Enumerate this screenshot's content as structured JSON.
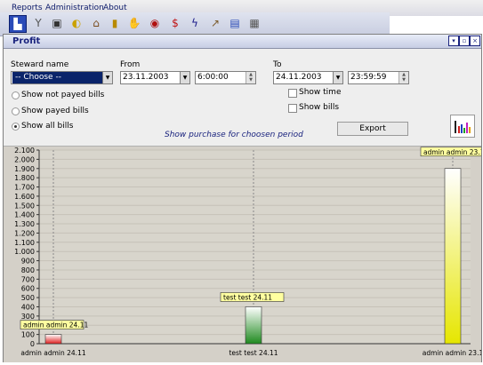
{
  "menu": [
    "Reports",
    "Administration",
    "About"
  ],
  "toolbar_icons": [
    "users-icon",
    "cocktail-icon",
    "monitor-icon",
    "drink-icon",
    "shop-icon",
    "bottle-icon",
    "scroll-icon",
    "money-icon",
    "cash-icon",
    "lightning-icon",
    "chart-icon",
    "card-icon",
    "document-icon"
  ],
  "window": {
    "title": "Profit"
  },
  "form": {
    "steward_label": "Steward name",
    "steward_value": "-- Choose --",
    "from_label": "From",
    "from_date": "23.11.2003",
    "from_time": "6:00:00",
    "to_label": "To",
    "to_date": "24.11.2003",
    "to_time": "23:59:59",
    "radios": [
      "Show not payed bills",
      "Show payed bills",
      "Show all bills"
    ],
    "selected_radio": 2,
    "show_time": "Show time",
    "show_bills": "Show bills",
    "export": "Export",
    "period_caption": "Show purchase for choosen period"
  },
  "chart_data": {
    "type": "bar",
    "categories": [
      "admin admin  24.11",
      "test test  24.11",
      "admin admin  23.1"
    ],
    "values": [
      100,
      400,
      1900
    ],
    "colors": [
      "#e02020",
      "#1f8a1f",
      "#e6e600"
    ],
    "ylim": [
      0,
      2100
    ],
    "yticks": [
      "0",
      "100",
      "200",
      "300",
      "400",
      "500",
      "600",
      "700",
      "800",
      "900",
      "1.000",
      "1.100",
      "1.200",
      "1.300",
      "1.400",
      "1.500",
      "1.600",
      "1.700",
      "1.800",
      "1.900",
      "2.000",
      "2.100"
    ],
    "grid": true
  }
}
